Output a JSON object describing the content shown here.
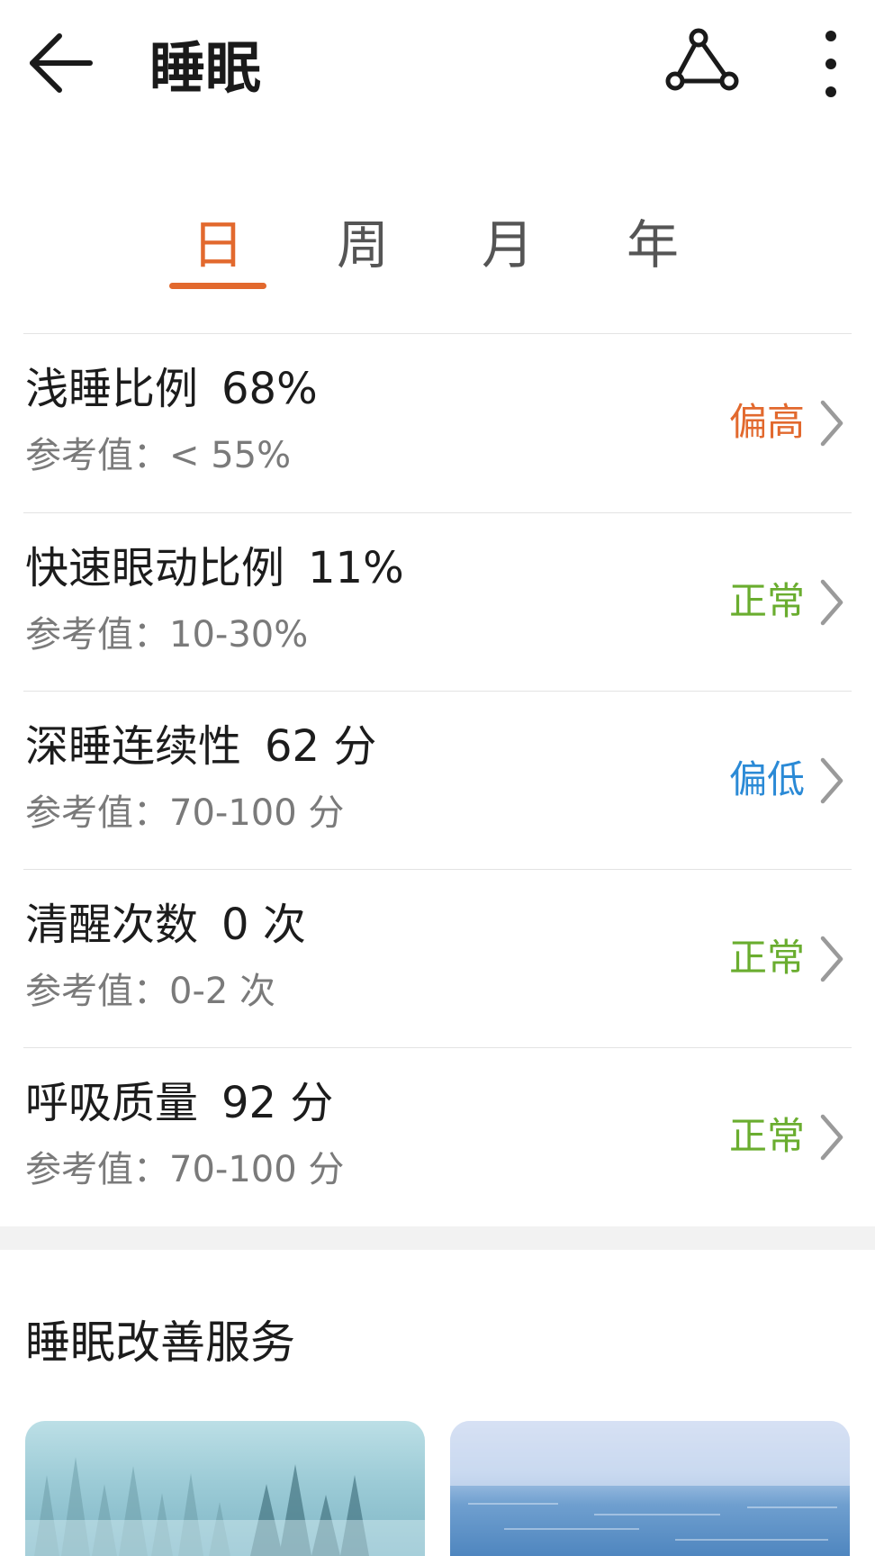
{
  "header": {
    "title": "睡眠",
    "back_icon": "arrow-left-icon",
    "share_icon": "share-icon",
    "more_icon": "more-vertical-icon"
  },
  "tabs": [
    {
      "label": "日",
      "active": true
    },
    {
      "label": "周",
      "active": false
    },
    {
      "label": "月",
      "active": false
    },
    {
      "label": "年",
      "active": false
    }
  ],
  "colors": {
    "accent": "#e2692e",
    "status_high": "#e2692e",
    "status_normal": "#6aad2f",
    "status_low": "#2b8ad6"
  },
  "metrics": [
    {
      "name": "浅睡比例",
      "value": "68%",
      "reference": "参考值：< 55%",
      "status": "偏高",
      "status_type": "high"
    },
    {
      "name": "快速眼动比例",
      "value": "11%",
      "reference": "参考值：10-30%",
      "status": "正常",
      "status_type": "normal"
    },
    {
      "name": "深睡连续性",
      "value": "62 分",
      "reference": "参考值：70-100 分",
      "status": "偏低",
      "status_type": "low"
    },
    {
      "name": "清醒次数",
      "value": "0 次",
      "reference": "参考值：0-2 次",
      "status": "正常",
      "status_type": "normal"
    },
    {
      "name": "呼吸质量",
      "value": "92 分",
      "reference": "参考值：70-100 分",
      "status": "正常",
      "status_type": "normal"
    }
  ],
  "services": {
    "title": "睡眠改善服务",
    "cards": [
      {
        "image": "misty-forest"
      },
      {
        "image": "sea-horizon"
      }
    ]
  }
}
